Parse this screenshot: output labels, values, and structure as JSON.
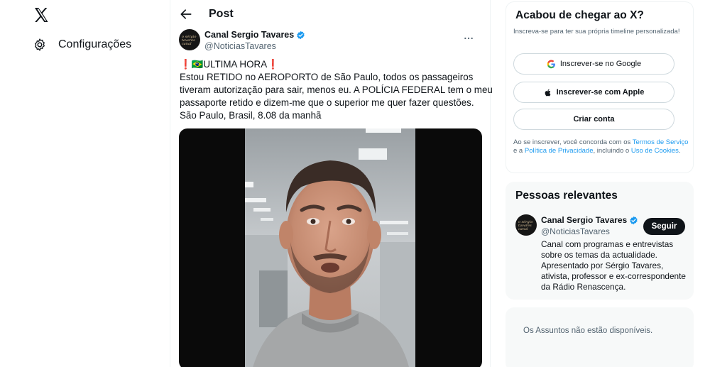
{
  "nav": {
    "settings_label": "Configurações"
  },
  "post": {
    "header_title": "Post",
    "author_name": "Canal Sergio Tavares",
    "author_handle": "@NoticiasTavares",
    "avatar_text": "o sérgio tavares canal",
    "text_lines": [
      "❗🇧🇷ULTIMA HORA❗",
      "Estou RETIDO no AEROPORTO de São Paulo, todos os passageiros",
      "tiveram autorização para sair, menos eu. A POLÍCIA FEDERAL tem o meu",
      "passaporte retido e dizem-me que o superior me quer fazer questões.",
      "São Paulo, Brasil, 8.08 da manhã"
    ]
  },
  "signup": {
    "title": "Acabou de chegar ao X?",
    "subtitle": "Inscreva-se para ter sua própria timeline personalizada!",
    "google_label": "Inscrever-se no Google",
    "apple_label": "Inscrever-se com Apple",
    "create_label": "Criar conta",
    "terms_prefix": "Ao se inscrever, você concorda com os ",
    "terms_link": "Termos de Serviço",
    "terms_mid1": " e a ",
    "privacy_link": "Política de Privacidade",
    "terms_mid2": ", incluindo o ",
    "cookies_link": "Uso de Cookies",
    "terms_end": "."
  },
  "people": {
    "title": "Pessoas relevantes",
    "name": "Canal Sergio Tavares",
    "handle": "@NoticiasTavares",
    "follow_label": "Seguir",
    "bio": "Canal com programas e entrevistas sobre os temas da actualidade. Apresentado por Sérgio Tavares, ativista, professor e ex-correspondente da Rádio Renascença."
  },
  "trends": {
    "message": "Os Assuntos não estão disponíveis."
  },
  "colors": {
    "accent": "#1d9bf0",
    "text": "#0f1419",
    "muted": "#536471",
    "border": "#eff3f4",
    "panel": "#f7f9f9"
  }
}
